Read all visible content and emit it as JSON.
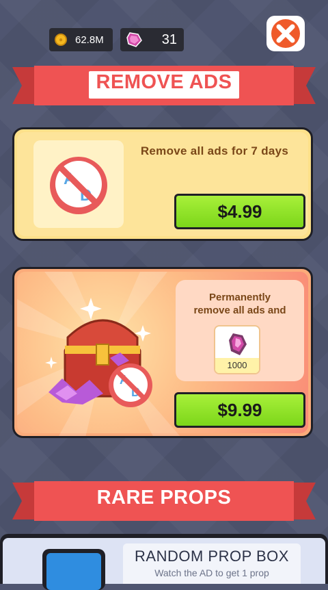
{
  "currency": {
    "coins": "62.8M",
    "gems": "31"
  },
  "header": {
    "title": "REMOVE ADS"
  },
  "offers": [
    {
      "description": "Remove all ads for 7 days",
      "price": "$4.99",
      "icon": "no-ads-icon"
    },
    {
      "description_line1": "Permanently",
      "description_line2": "remove all ads and",
      "bonus_gems": "1000",
      "price": "$9.99",
      "icon": "treasure-chest-icon"
    }
  ],
  "rare_props": {
    "title": "RARE PROPS",
    "item_title": "RANDOM PROP BOX",
    "item_subtitle": "Watch the AD to get 1 prop"
  },
  "colors": {
    "background": "#4f5570",
    "ribbon": "#ef5353",
    "buy_button": "#8ee028",
    "card1_bg": "#fde08a",
    "card2_bg": "#fbab7a",
    "close_button": "#ef5a2a",
    "text_brown": "#7a4718"
  }
}
